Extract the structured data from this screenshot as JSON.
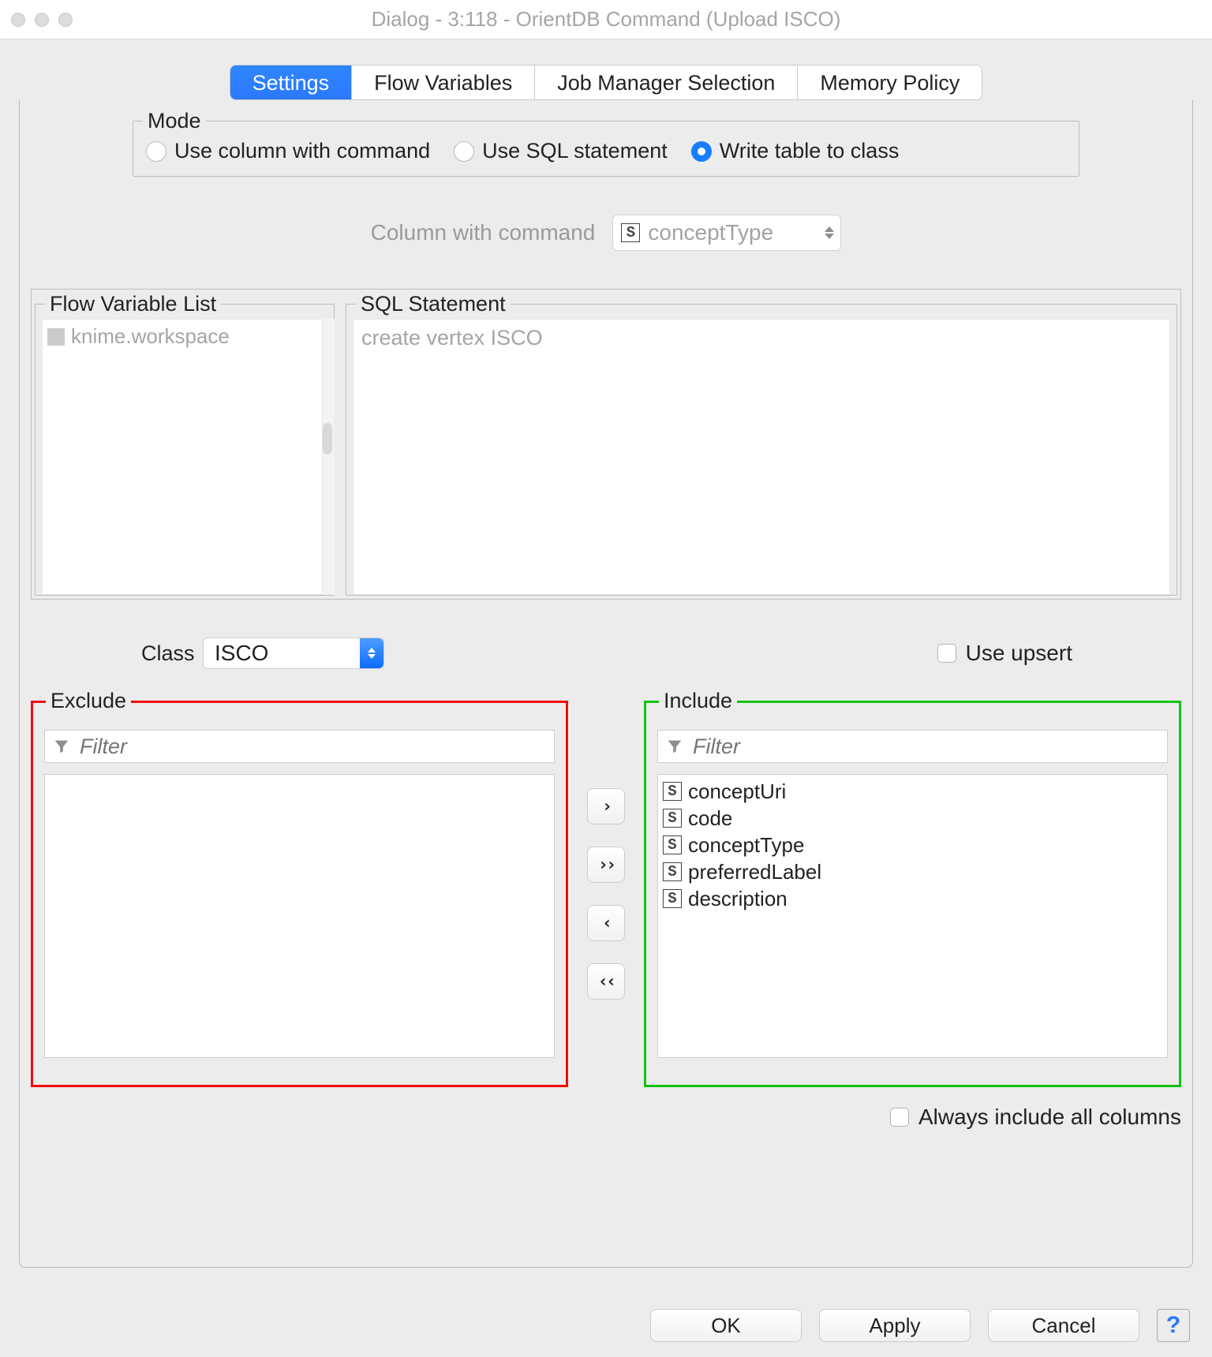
{
  "window_title": "Dialog - 3:118 - OrientDB Command (Upload ISCO)",
  "tabs": {
    "settings": "Settings",
    "flow_variables": "Flow Variables",
    "job_manager": "Job Manager Selection",
    "memory_policy": "Memory Policy"
  },
  "mode": {
    "legend": "Mode",
    "use_column": "Use column with command",
    "use_sql": "Use SQL statement",
    "write_table": "Write table to class"
  },
  "column_with_command": {
    "label": "Column with command",
    "value": "conceptType"
  },
  "flow_var_list": {
    "legend": "Flow Variable List",
    "items": [
      "knime.workspace"
    ]
  },
  "sql_statement": {
    "legend": "SQL Statement",
    "text": "create vertex ISCO"
  },
  "class": {
    "label": "Class",
    "value": "ISCO"
  },
  "use_upsert_label": "Use upsert",
  "exclude": {
    "legend": "Exclude",
    "filter_placeholder": "Filter",
    "items": []
  },
  "include": {
    "legend": "Include",
    "filter_placeholder": "Filter",
    "items": [
      "conceptUri",
      "code",
      "conceptType",
      "preferredLabel",
      "description"
    ]
  },
  "always_include_label": "Always include all columns",
  "buttons": {
    "ok": "OK",
    "apply": "Apply",
    "cancel": "Cancel"
  }
}
